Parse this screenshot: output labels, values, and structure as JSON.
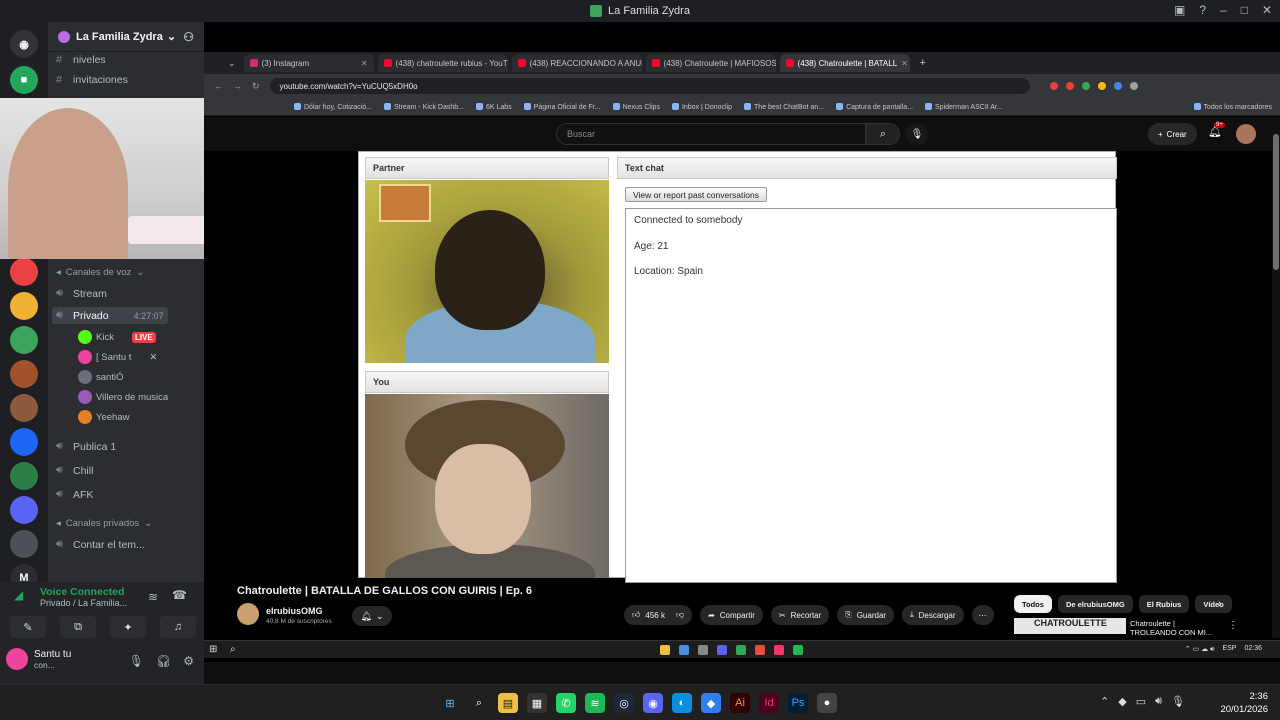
{
  "window": {
    "title": "La Familia Zydra"
  },
  "server": {
    "name": "La Familia Zydra"
  },
  "sidebar": {
    "channels": [
      {
        "name": "niveles"
      },
      {
        "name": "invitaciones"
      }
    ],
    "category_voice": "Canales de voz",
    "voice_channels": [
      {
        "name": "Stream"
      },
      {
        "name": "Privado",
        "timer": "4:27:07"
      },
      {
        "name": "Publica 1"
      },
      {
        "name": "Chill"
      },
      {
        "name": "AFK"
      }
    ],
    "voice_users": [
      {
        "name": "Kick",
        "badge": "LIVE"
      },
      {
        "name": "[ Santu t"
      },
      {
        "name": "santiÓ"
      },
      {
        "name": "Villero de musica"
      },
      {
        "name": "Yeehaw"
      }
    ],
    "category_private": "Canales privados",
    "private_channels": [
      {
        "name": "Contar el tem..."
      }
    ]
  },
  "voice_panel": {
    "status": "Voice Connected",
    "channel": "Privado / La Familia...",
    "user_name": "Santu tu",
    "user_status": "con..."
  },
  "browser": {
    "tabs": [
      {
        "label": "(3) Instagram"
      },
      {
        "label": "(438) chatroulette rubius - YouT"
      },
      {
        "label": "(438) REACCIONANDO A ANUNC"
      },
      {
        "label": "(438) Chatroulette | MAFIOSOS"
      },
      {
        "label": "(438) Chatroulette | BATALL",
        "active": true
      }
    ],
    "url": "youtube.com/watch?v=YuCUQ5xDH0o",
    "bookmarks": [
      "Dólar hoy, Cotizació...",
      "Stream - Kick Dashb...",
      "6K Labs",
      "Página Oficial de Fr...",
      "Nexus Clips",
      "Inbox | Donoclip",
      "The best ChatBot an...",
      "Captura de pantalla...",
      "Spiderman ASCII Ar..."
    ],
    "bookmarks_all": "Todos los marcadores"
  },
  "youtube": {
    "search_placeholder": "Buscar",
    "create_label": "Crear",
    "notif_count": "9+",
    "video_title": "Chatroulette | BATALLA DE GALLOS CON GUIRIS | Ep. 6",
    "channel_name": "elrubiusOMG",
    "subscribers": "40,8 M de suscriptores",
    "likes": "456 k",
    "share": "Compartir",
    "clip": "Recortar",
    "save": "Guardar",
    "download": "Descargar",
    "chips": [
      "Todos",
      "De elrubiusOMG",
      "El Rubius",
      "Vídeo"
    ],
    "rec_thumb_text": "CHATROULETTE",
    "rec_title_line1": "Chatroulette |",
    "rec_title_line2": "TROLEANDO CON MI..."
  },
  "chatroulette": {
    "partner_label": "Partner",
    "you_label": "You",
    "text_chat_label": "Text chat",
    "report_button": "View or report past conversations",
    "messages": [
      "Connected to somebody",
      "Age: 21",
      "Location: Spain"
    ]
  },
  "inner_taskbar": {
    "lang": "ESP",
    "time": "02:36"
  },
  "taskbar": {
    "time": "2:36",
    "date": "20/01/2026"
  }
}
